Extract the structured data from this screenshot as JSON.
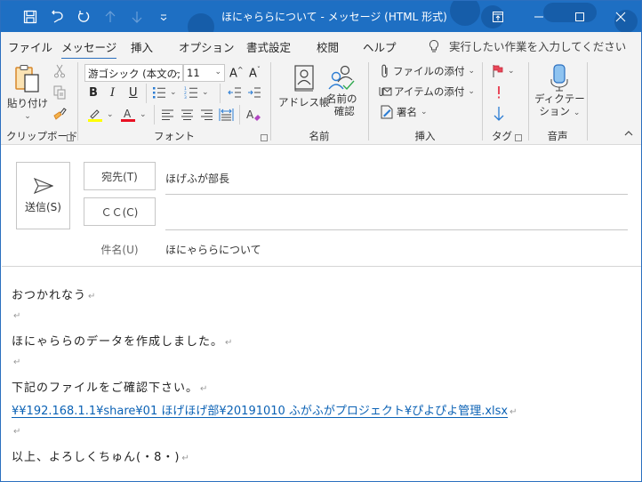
{
  "window": {
    "title": "ほにゃららについて  -  メッセージ (HTML 形式)",
    "accent": "#1e6fc3"
  },
  "qat": {
    "icons": [
      "save-icon",
      "undo-icon",
      "redo-icon",
      "previous-item-icon",
      "next-item-icon",
      "customize-qat-icon"
    ]
  },
  "window_controls": [
    "restore-ribbon-icon",
    "minimize-icon",
    "maximize-icon",
    "close-icon"
  ],
  "tabs": [
    {
      "label": "ファイル",
      "active": false
    },
    {
      "label": "メッセージ",
      "active": true
    },
    {
      "label": "挿入",
      "active": false
    },
    {
      "label": "オプション",
      "active": false
    },
    {
      "label": "書式設定",
      "active": false
    },
    {
      "label": "校閲",
      "active": false
    },
    {
      "label": "ヘルプ",
      "active": false
    }
  ],
  "tell_me": {
    "placeholder": "実行したい作業を入力してください"
  },
  "ribbon": {
    "clipboard": {
      "paste": "貼り付け",
      "label": "クリップボード"
    },
    "font": {
      "font_name": "游ゴシック (本文の;",
      "font_size": "11",
      "label": "フォント",
      "highlight_color": "#ffff00",
      "font_color": "#e81123"
    },
    "names": {
      "address_book": "アドレス帳",
      "check_names_1": "名前の",
      "check_names_2": "確認",
      "label": "名前"
    },
    "include": {
      "attach_file": "ファイルの添付",
      "attach_item": "アイテムの添付",
      "signature": "署名",
      "label": "挿入"
    },
    "tags": {
      "label": "タグ"
    },
    "voice": {
      "dictate_1": "ディクテー",
      "dictate_2": "ション",
      "label": "音声"
    }
  },
  "compose": {
    "send": "送信(S)",
    "to_button": "宛先(T)",
    "to_value": "ほげふが部長",
    "cc_button": "ＣＣ(C)",
    "cc_value": "",
    "subject_label": "件名(U)",
    "subject_value": "ほにゃららについて"
  },
  "body": {
    "lines": [
      "おつかれなう",
      "",
      "ほにゃららのデータを作成しました。",
      "",
      "下記のファイルをご確認下さい。",
      "¥¥192.168.1.1¥share¥01 ほげほげ部¥20191010 ふがふがプロジェクト¥ぴよぴよ管理.xlsx",
      "",
      "以上、よろしくちゅん(・8・)"
    ],
    "paragraph_mark": "↵",
    "link_color": "#0b62b5"
  }
}
